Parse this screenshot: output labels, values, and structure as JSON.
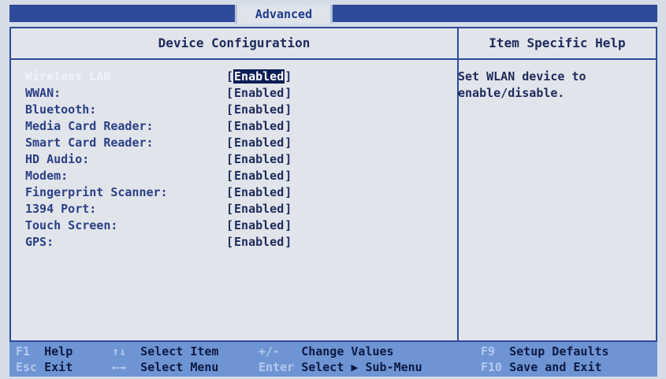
{
  "menu": {
    "active_tab": "Advanced"
  },
  "panel": {
    "title": "Device Configuration",
    "help_title": "Item Specific Help",
    "help_text": "Set WLAN device to\nenable/disable."
  },
  "settings": [
    {
      "label": "Wireless LAN",
      "value": "Enabled",
      "selected": true
    },
    {
      "label": "WWAN:",
      "value": "Enabled"
    },
    {
      "label": "Bluetooth:",
      "value": "Enabled"
    },
    {
      "label": "Media Card Reader:",
      "value": "Enabled"
    },
    {
      "label": "Smart Card Reader:",
      "value": "Enabled"
    },
    {
      "label": "HD Audio:",
      "value": "Enabled"
    },
    {
      "label": "Modem:",
      "value": "Enabled"
    },
    {
      "label": "Fingerprint Scanner:",
      "value": "Enabled"
    },
    {
      "label": "1394 Port:",
      "value": "Enabled"
    },
    {
      "label": "Touch Screen:",
      "value": "Enabled"
    },
    {
      "label": "GPS:",
      "value": "Enabled"
    }
  ],
  "footer": {
    "f1_key": "F1",
    "f1_label": "Help",
    "updown_key": "↑↓",
    "updown_label": "Select Item",
    "plusminus_key": "+/-",
    "plusminus_label": "Change Values",
    "f9_key": "F9",
    "f9_label": "Setup Defaults",
    "esc_key": "Esc",
    "esc_label": "Exit",
    "leftright_key": "←→",
    "leftright_label": "Select Menu",
    "enter_key": "Enter",
    "enter_label": "Select ▶ Sub-Menu",
    "f10_key": "F10",
    "f10_label": "Save and Exit"
  }
}
